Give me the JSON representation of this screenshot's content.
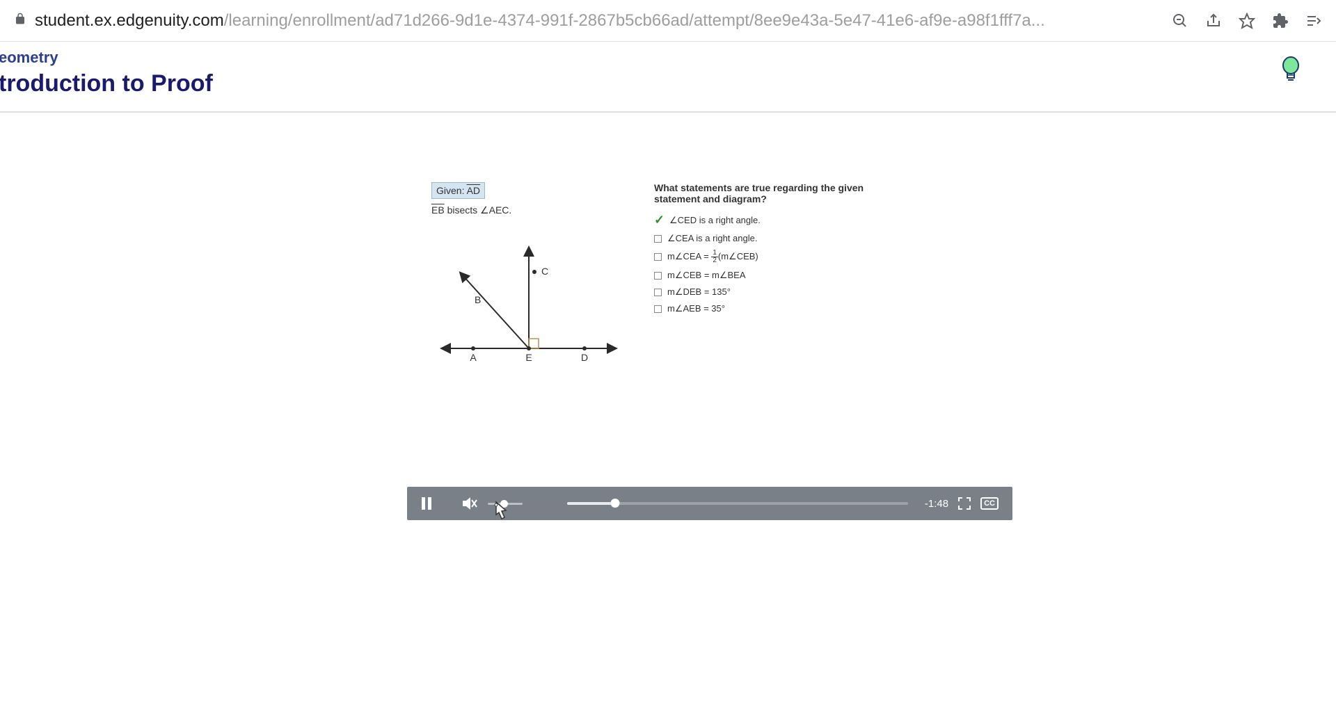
{
  "browser": {
    "url_domain": "student.ex.edgenuity.com",
    "url_path": "/learning/enrollment/ad71d266-9d1e-4374-991f-2867b5cb66ad/attempt/8ee9e43a-5e47-41e6-af9e-a98f1fff7a..."
  },
  "header": {
    "course": "eometry",
    "lesson": "troduction to Proof"
  },
  "diagram": {
    "given_prefix": "Given: ",
    "given_line": "AD",
    "bisect_line": "EB",
    "bisect_text": " bisects ",
    "bisect_angle": "AEC.",
    "labels": {
      "A": "A",
      "B": "B",
      "C": "C",
      "D": "D",
      "E": "E"
    }
  },
  "question": {
    "prompt": "What statements are true regarding the given statement and diagram?",
    "options": [
      {
        "checked": true,
        "text": "∠CED is a right angle."
      },
      {
        "checked": false,
        "text": "∠CEA is a right angle."
      },
      {
        "checked": false,
        "text_pre": "m∠CEA = ",
        "frac_num": "1",
        "frac_den": "2",
        "text_post": "(m∠CEB)"
      },
      {
        "checked": false,
        "text": "m∠CEB = m∠BEA"
      },
      {
        "checked": false,
        "text": "m∠DEB = 135°"
      },
      {
        "checked": false,
        "text": "m∠AEB = 35°"
      }
    ]
  },
  "video": {
    "time_remaining": "-1:48",
    "cc_label": "CC",
    "progress_percent": 14,
    "volume_percent": 36
  }
}
